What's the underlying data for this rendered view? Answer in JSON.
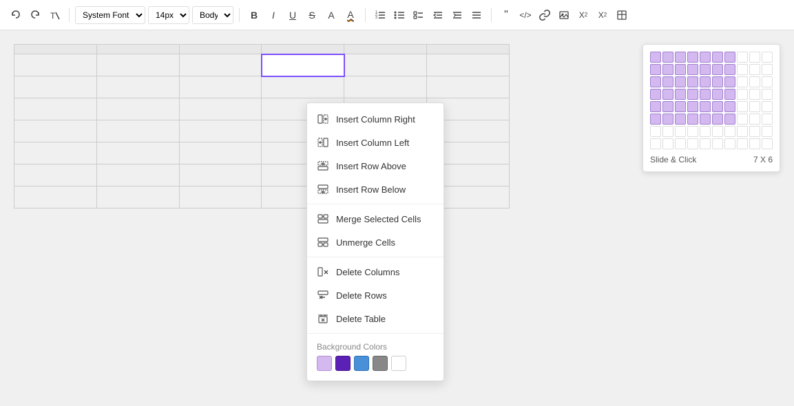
{
  "toolbar": {
    "font_family": "System Font",
    "font_size": "14px",
    "style": "Body",
    "bold": "B",
    "italic": "I",
    "underline": "U",
    "strikethrough": "S",
    "font_color": "A",
    "highlight": "A~",
    "undo_label": "undo",
    "redo_label": "redo",
    "clear_label": "clear"
  },
  "context_menu": {
    "items": [
      {
        "id": "insert-col-right",
        "label": "Insert Column Right",
        "icon": "insert-col-right-icon"
      },
      {
        "id": "insert-col-left",
        "label": "Insert Column Left",
        "icon": "insert-col-left-icon"
      },
      {
        "id": "insert-row-above",
        "label": "Insert Row Above",
        "icon": "insert-row-above-icon"
      },
      {
        "id": "insert-row-below",
        "label": "Insert Row Below",
        "icon": "insert-row-below-icon"
      },
      {
        "id": "merge-cells",
        "label": "Merge Selected Cells",
        "icon": "merge-cells-icon"
      },
      {
        "id": "unmerge-cells",
        "label": "Unmerge Cells",
        "icon": "unmerge-cells-icon"
      },
      {
        "id": "delete-columns",
        "label": "Delete Columns",
        "icon": "delete-columns-icon"
      },
      {
        "id": "delete-rows",
        "label": "Delete Rows",
        "icon": "delete-rows-icon"
      },
      {
        "id": "delete-table",
        "label": "Delete Table",
        "icon": "delete-table-icon"
      }
    ],
    "bg_colors_label": "Background Colors",
    "bg_colors": [
      {
        "id": "color-lavender",
        "hex": "#d4b8f0"
      },
      {
        "id": "color-purple",
        "hex": "#5b21b6"
      },
      {
        "id": "color-blue",
        "hex": "#4a90d9"
      },
      {
        "id": "color-gray",
        "hex": "#888888"
      },
      {
        "id": "color-white",
        "hex": "#ffffff"
      }
    ]
  },
  "grid_picker": {
    "label": "Slide & Click",
    "size_label": "7 X 6",
    "cols": 10,
    "rows": 8,
    "active_cols": 7,
    "active_rows": 6
  }
}
